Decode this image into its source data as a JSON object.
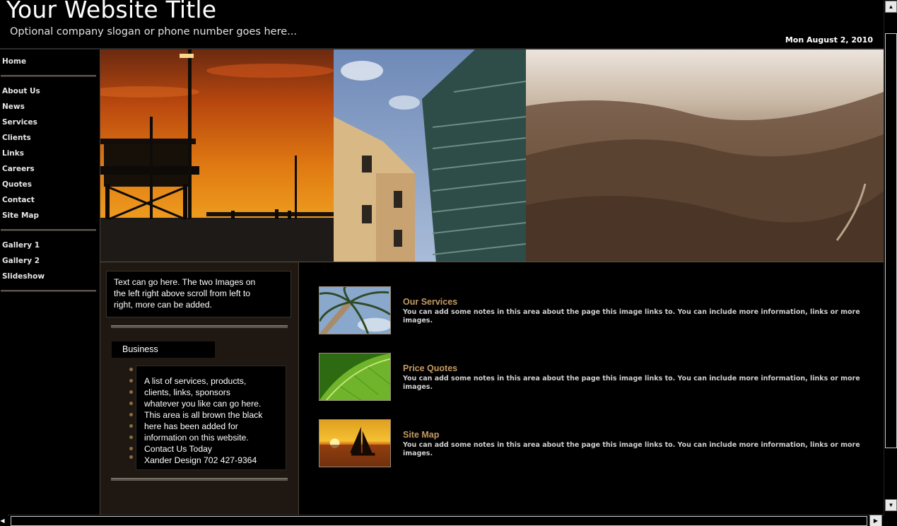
{
  "header": {
    "title": "Your Website Title",
    "slogan": "Optional company slogan or phone number goes here...",
    "date": "Mon August 2, 2010"
  },
  "nav": {
    "home": "Home",
    "about": "About Us",
    "news": "News",
    "services": "Services",
    "clients": "Clients",
    "links": "Links",
    "careers": "Careers",
    "quotes": "Quotes",
    "contact": "Contact",
    "sitemap": "Site Map",
    "gallery1": "Gallery 1",
    "gallery2": "Gallery 2",
    "slideshow": "Slideshow"
  },
  "sidebar_text": {
    "intro_lines": [
      "Text can go here. The two Images on",
      "the left right above scroll from left to",
      "right,  more can be added."
    ],
    "business_heading": "Business",
    "list_lines": [
      "A list of services, products,",
      "clients, links, sponsors",
      "whatever you like can go here.",
      "This area is all brown the black",
      "here has been added for",
      "information on this website.",
      "Contact Us Today",
      "Xander Design 702 427-9364"
    ]
  },
  "features": [
    {
      "title": "Our Services",
      "desc": "You can add some notes in this area about the page this image links to. You can include more information, links or more images.",
      "icon": "palm-tree-image"
    },
    {
      "title": "Price Quotes",
      "desc": "You can add some notes in this area about the page this image links to. You can include more information, links or more images.",
      "icon": "green-leaf-image"
    },
    {
      "title": "Site Map",
      "desc": "You can add some notes in this area about the page this image links to. You can include more information, links or more images.",
      "icon": "sailboat-sunset-image"
    }
  ],
  "colors": {
    "accent": "#c49a62",
    "brown_panel": "#1f1812",
    "bullet": "#8c6c43"
  },
  "scrollbars": {
    "up_arrow": "▲",
    "down_arrow": "▼",
    "left_arrow": "◀",
    "right_arrow": "▶"
  }
}
